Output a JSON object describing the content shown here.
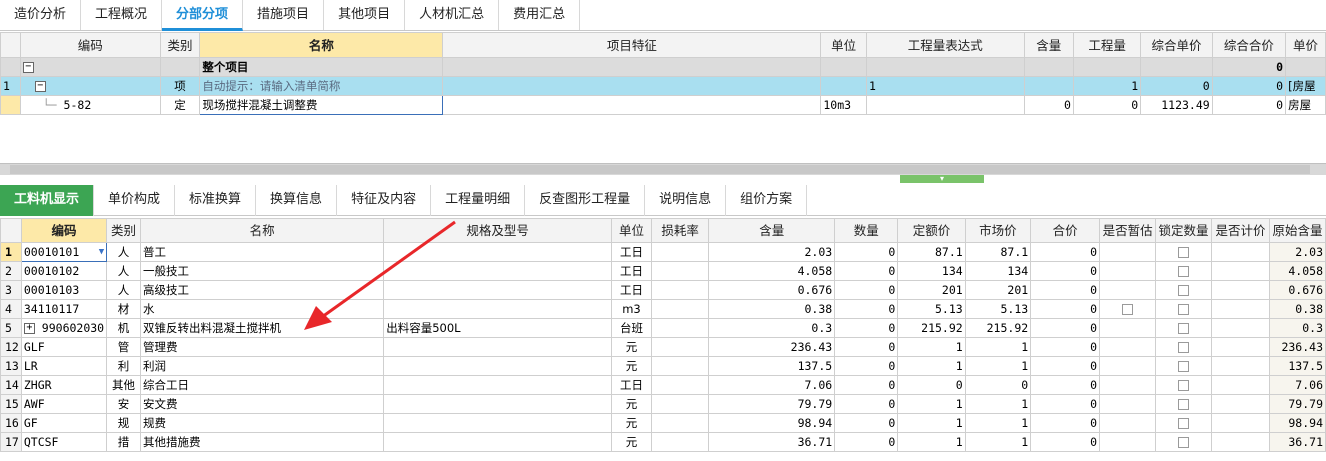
{
  "top_tabs": [
    "造价分析",
    "工程概况",
    "分部分项",
    "措施项目",
    "其他项目",
    "人材机汇总",
    "费用汇总"
  ],
  "top_active": 2,
  "grid1": {
    "headers": [
      "编码",
      "类别",
      "名称",
      "项目特征",
      "单位",
      "工程量表达式",
      "含量",
      "工程量",
      "综合单价",
      "综合合价",
      "单价"
    ],
    "group_row": {
      "name": "整个项目",
      "total": "0"
    },
    "row1": {
      "num": "1",
      "category": "项",
      "name_hint": "自动提示：请输入清单简称",
      "expression": "1",
      "quantity": "1",
      "unit_price": "0",
      "total": "0",
      "extra": "[房屋"
    },
    "row2": {
      "code": "5-82",
      "category": "定",
      "name": "现场搅拌混凝土调整费",
      "unit": "10m3",
      "content": "0",
      "quantity": "0",
      "unit_price": "1123.49",
      "total": "0",
      "extra": "房屋"
    }
  },
  "bottom_tabs": [
    "工料机显示",
    "单价构成",
    "标准换算",
    "换算信息",
    "特征及内容",
    "工程量明细",
    "反查图形工程量",
    "说明信息",
    "组价方案"
  ],
  "bottom_active": 0,
  "grid2": {
    "headers": [
      "编码",
      "类别",
      "名称",
      "规格及型号",
      "单位",
      "损耗率",
      "含量",
      "数量",
      "定额价",
      "市场价",
      "合价",
      "是否暂估",
      "锁定数量",
      "是否计价",
      "原始含量"
    ],
    "rows": [
      {
        "n": "1",
        "code": "00010101",
        "cat": "人",
        "name": "普工",
        "spec": "",
        "unit": "工日",
        "loss": "",
        "content": "2.03",
        "qty": "0",
        "quota": "87.1",
        "market": "87.1",
        "total": "0",
        "orig": "2.03"
      },
      {
        "n": "2",
        "code": "00010102",
        "cat": "人",
        "name": "一般技工",
        "spec": "",
        "unit": "工日",
        "loss": "",
        "content": "4.058",
        "qty": "0",
        "quota": "134",
        "market": "134",
        "total": "0",
        "orig": "4.058"
      },
      {
        "n": "3",
        "code": "00010103",
        "cat": "人",
        "name": "高级技工",
        "spec": "",
        "unit": "工日",
        "loss": "",
        "content": "0.676",
        "qty": "0",
        "quota": "201",
        "market": "201",
        "total": "0",
        "orig": "0.676"
      },
      {
        "n": "4",
        "code": "34110117",
        "cat": "材",
        "name": "水",
        "spec": "",
        "unit": "m3",
        "loss": "",
        "content": "0.38",
        "qty": "0",
        "quota": "5.13",
        "market": "5.13",
        "total": "0",
        "orig": "0.38"
      },
      {
        "n": "5",
        "code": "990602030",
        "cat": "机",
        "name": "双锥反转出料混凝土搅拌机",
        "spec": "出料容量500L",
        "unit": "台班",
        "loss": "",
        "content": "0.3",
        "qty": "0",
        "quota": "215.92",
        "market": "215.92",
        "total": "0",
        "orig": "0.3"
      },
      {
        "n": "12",
        "code": "GLF",
        "cat": "管",
        "name": "管理费",
        "spec": "",
        "unit": "元",
        "loss": "",
        "content": "236.43",
        "qty": "0",
        "quota": "1",
        "market": "1",
        "total": "0",
        "orig": "236.43"
      },
      {
        "n": "13",
        "code": "LR",
        "cat": "利",
        "name": "利润",
        "spec": "",
        "unit": "元",
        "loss": "",
        "content": "137.5",
        "qty": "0",
        "quota": "1",
        "market": "1",
        "total": "0",
        "orig": "137.5"
      },
      {
        "n": "14",
        "code": "ZHGR",
        "cat": "其他",
        "name": "综合工日",
        "spec": "",
        "unit": "工日",
        "loss": "",
        "content": "7.06",
        "qty": "0",
        "quota": "0",
        "market": "0",
        "total": "0",
        "orig": "7.06"
      },
      {
        "n": "15",
        "code": "AWF",
        "cat": "安",
        "name": "安文费",
        "spec": "",
        "unit": "元",
        "loss": "",
        "content": "79.79",
        "qty": "0",
        "quota": "1",
        "market": "1",
        "total": "0",
        "orig": "79.79"
      },
      {
        "n": "16",
        "code": "GF",
        "cat": "规",
        "name": "规费",
        "spec": "",
        "unit": "元",
        "loss": "",
        "content": "98.94",
        "qty": "0",
        "quota": "1",
        "market": "1",
        "total": "0",
        "orig": "98.94"
      },
      {
        "n": "17",
        "code": "QTCSF",
        "cat": "措",
        "name": "其他措施费",
        "spec": "",
        "unit": "元",
        "loss": "",
        "content": "36.71",
        "qty": "0",
        "quota": "1",
        "market": "1",
        "total": "0",
        "orig": "36.71"
      }
    ]
  },
  "colors": {
    "accent_blue": "#1f8fd8",
    "active_green": "#3ca553",
    "selected_row": "#a9dff0",
    "header_highlight": "#fde9a8",
    "annotation_red": "#e8272a"
  }
}
